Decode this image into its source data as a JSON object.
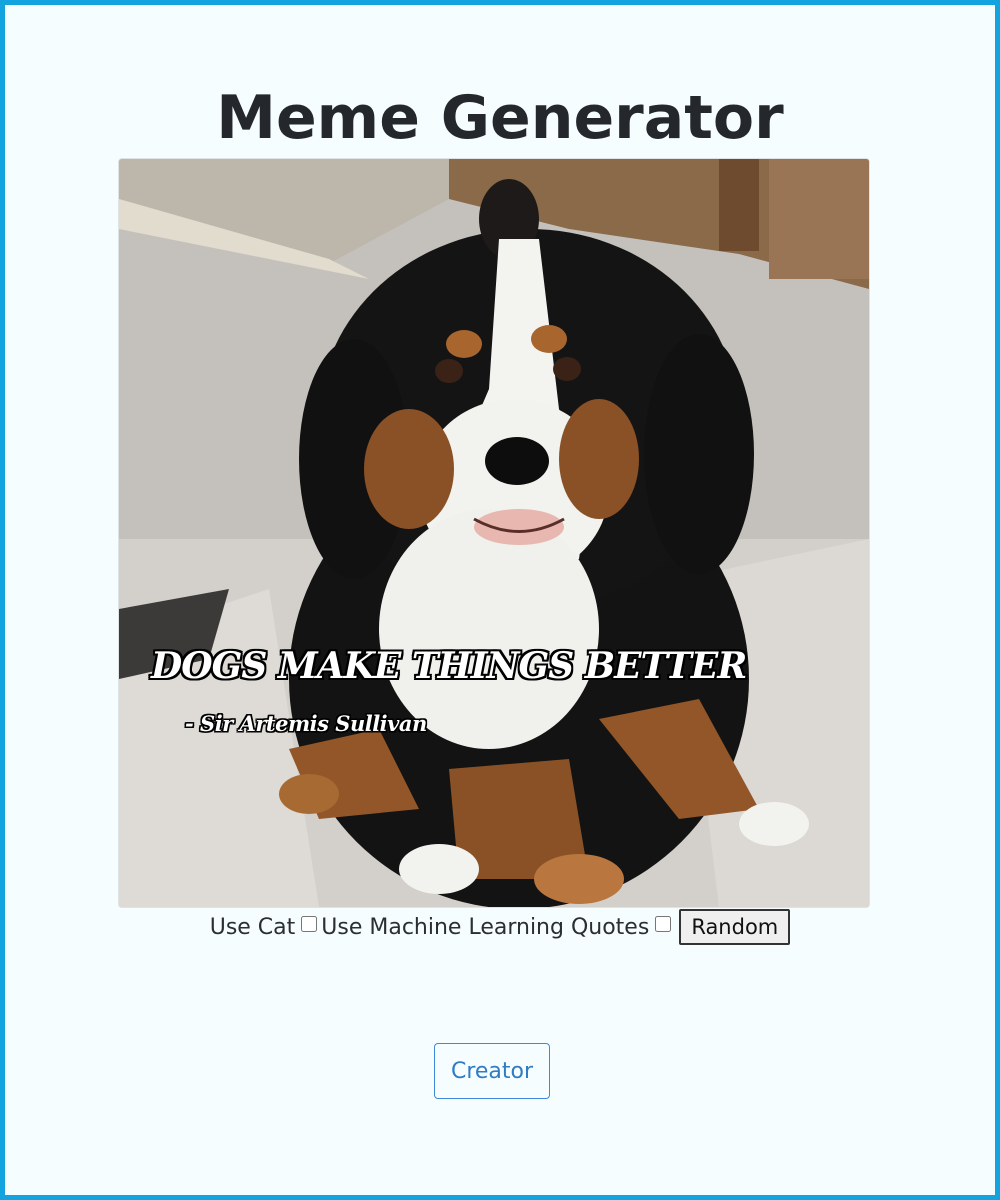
{
  "page": {
    "title": "Meme Generator"
  },
  "meme": {
    "image_description": "dog-photo",
    "quote": "DOGS MAKE THINGS BETTER",
    "author": "- Sir Artemis Sullivan"
  },
  "controls": {
    "use_cat_label": "Use Cat",
    "use_cat_checked": false,
    "use_ml_label": "Use Machine Learning Quotes",
    "use_ml_checked": false,
    "random_label": "Random"
  },
  "footer": {
    "creator_label": "Creator"
  },
  "colors": {
    "border_accent": "#13a3df",
    "background": "#f6fdff",
    "creator_button": "#3d8bd9"
  }
}
